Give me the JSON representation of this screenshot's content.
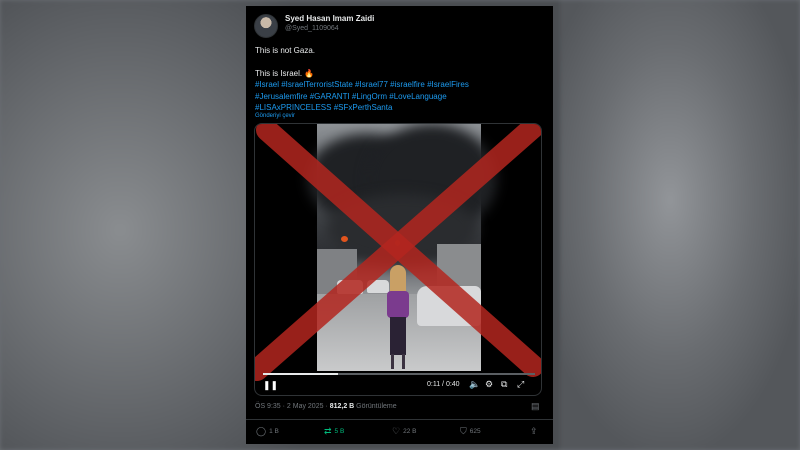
{
  "author": {
    "display_name": "Syed Hasan Imam Zaidi",
    "handle": "@Syed_1109064"
  },
  "tweet": {
    "line1": "This is not Gaza.",
    "line2": "This is Israel. 🔥",
    "hashtags_line1": "#Israel #IsraelTerroristState #Israel77 #israelfire #IsraelFires",
    "hashtags_line2": "#Jerusalemfire  #GARANTI #LingOrm #LoveLanguage",
    "hashtags_line3": "#LISAxPRINCELESS #SFxPerthSanta",
    "translate_link": "Gönderiyi çevir"
  },
  "video": {
    "time": "0:11 / 0:40",
    "progress": 0.275,
    "overlay_color": "#b3261e"
  },
  "meta": {
    "time_date": "ÖS 9:35 · 2 May 2025 · ",
    "views_count": "812,2 B",
    "views_label": " Görüntüleme"
  },
  "actions": {
    "replies": "1 B",
    "retweets": "5 B",
    "likes": "22 B",
    "bookmarks": "625"
  },
  "colors": {
    "accent": "#1d9bf0",
    "retweet": "#00ba7c",
    "cross": "#b3261e"
  }
}
